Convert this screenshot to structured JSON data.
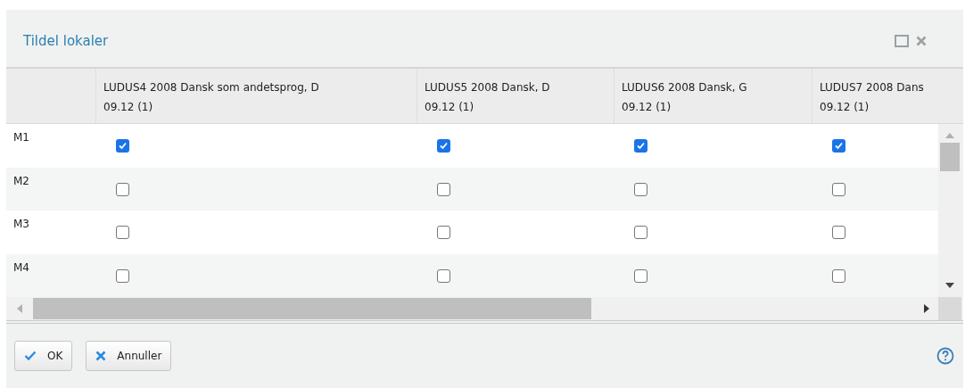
{
  "dialog": {
    "title": "Tildel lokaler"
  },
  "table": {
    "columns": [
      {
        "name": "LUDUS4 2008 Dansk som andetsprog, D",
        "date": "09.12 (1)"
      },
      {
        "name": "LUDUS5 2008 Dansk, D",
        "date": "09.12 (1)"
      },
      {
        "name": "LUDUS6 2008 Dansk, G",
        "date": "09.12 (1)"
      },
      {
        "name": "LUDUS7 2008 Dans",
        "date": "09.12 (1)"
      }
    ],
    "rows": [
      {
        "label": "M1",
        "cells": [
          {
            "checked": true
          },
          {
            "checked": true
          },
          {
            "checked": true
          },
          {
            "checked": true
          }
        ]
      },
      {
        "label": "M2",
        "cells": [
          {
            "checked": false
          },
          {
            "checked": false
          },
          {
            "checked": false
          },
          {
            "checked": false
          }
        ]
      },
      {
        "label": "M3",
        "cells": [
          {
            "checked": false
          },
          {
            "checked": false
          },
          {
            "checked": false
          },
          {
            "checked": false
          }
        ]
      },
      {
        "label": "M4",
        "cells": [
          {
            "checked": false
          },
          {
            "checked": false
          },
          {
            "checked": false
          },
          {
            "checked": false
          }
        ]
      }
    ]
  },
  "buttons": [
    {
      "kind": "ok",
      "label": "OK"
    },
    {
      "kind": "cancel",
      "label": "Annuller"
    }
  ]
}
